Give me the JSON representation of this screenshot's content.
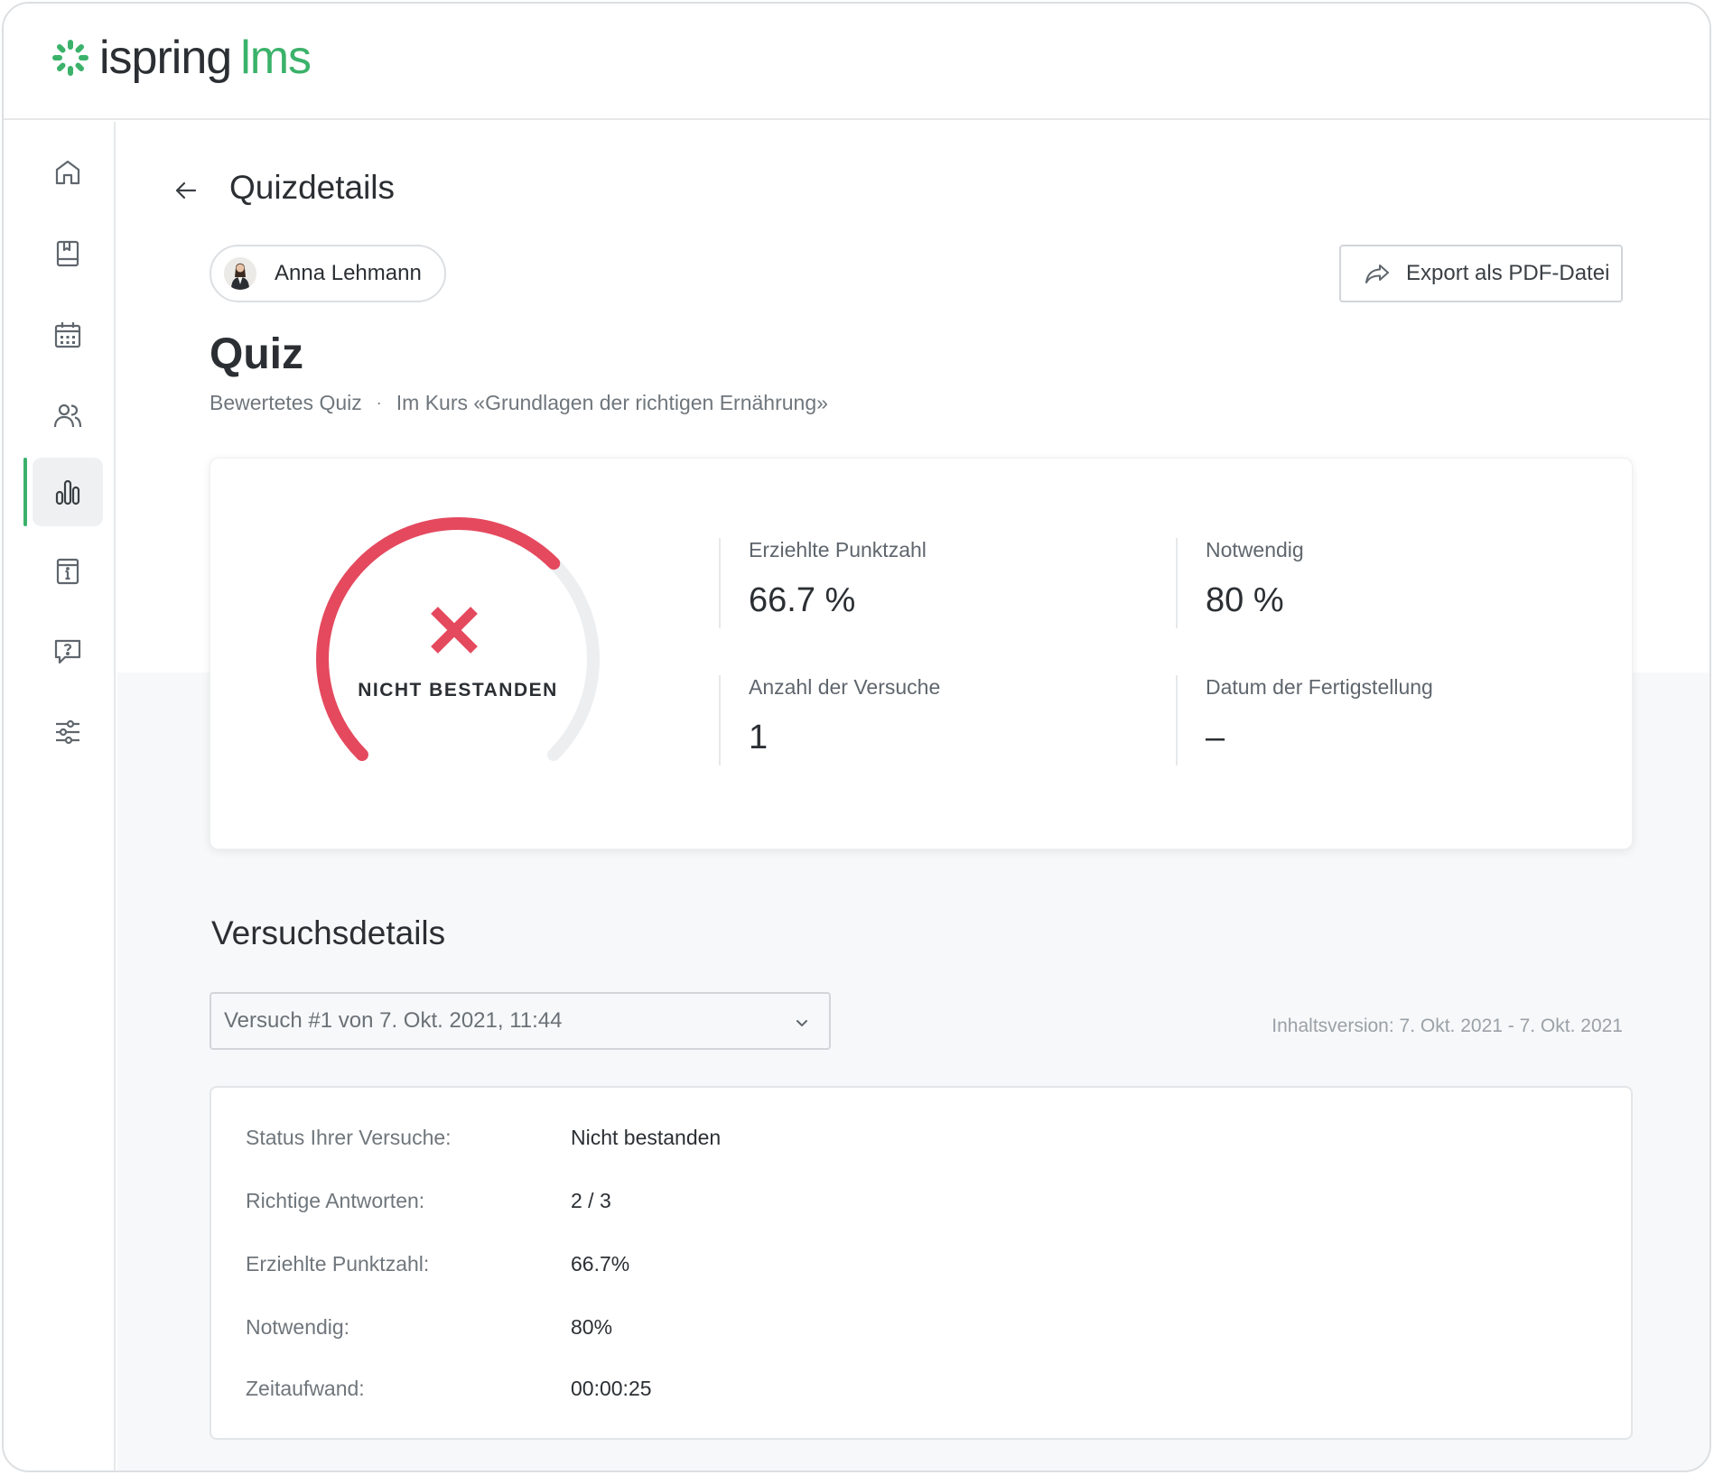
{
  "app": {
    "logo_text_1": "ispring",
    "logo_text_2": "lms",
    "brand_color": "#3bb26a",
    "fail_color": "#e5495e"
  },
  "sidebar": {
    "items": [
      {
        "name": "home",
        "icon": "home-icon",
        "active": false
      },
      {
        "name": "courses",
        "icon": "book-icon",
        "active": false
      },
      {
        "name": "calendar",
        "icon": "calendar-icon",
        "active": false
      },
      {
        "name": "users",
        "icon": "users-icon",
        "active": false
      },
      {
        "name": "reports",
        "icon": "bar-chart-icon",
        "active": true
      },
      {
        "name": "info",
        "icon": "info-icon",
        "active": false
      },
      {
        "name": "help",
        "icon": "question-icon",
        "active": false
      },
      {
        "name": "settings",
        "icon": "sliders-icon",
        "active": false
      }
    ]
  },
  "page": {
    "title": "Quizdetails",
    "user_name": "Anna Lehmann",
    "export_label": "Export als PDF-Datei",
    "quiz_title": "Quiz",
    "quiz_type": "Bewertetes Quiz",
    "quiz_dot": "·",
    "quiz_course": "Im Kurs «Grundlagen der richtigen Ernährung»"
  },
  "summary": {
    "gauge_status": "NICHT BESTANDEN",
    "gauge_fraction": 0.667,
    "stats": {
      "score_label": "Erziehlte Punktzahl",
      "score_value": "66.7 %",
      "required_label": "Notwendig",
      "required_value": "80 %",
      "attempts_label": "Anzahl der Versuche",
      "attempts_value": "1",
      "completed_label": "Datum der Fertigstellung",
      "completed_value": "–"
    }
  },
  "attempt": {
    "section_title": "Versuchsdetails",
    "selected": "Versuch #1 von 7. Okt. 2021, 11:44",
    "version_note": "Inhaltsversion: 7. Okt. 2021 - 7. Okt. 2021",
    "rows": [
      {
        "label": "Status Ihrer Versuche:",
        "value": "Nicht bestanden"
      },
      {
        "label": "Richtige Antworten:",
        "value": "2 / 3"
      },
      {
        "label": "Erziehlte Punktzahl:",
        "value": "66.7%"
      },
      {
        "label": "Notwendig:",
        "value": "80%"
      },
      {
        "label": "Zeitaufwand:",
        "value": "00:00:25"
      }
    ]
  }
}
